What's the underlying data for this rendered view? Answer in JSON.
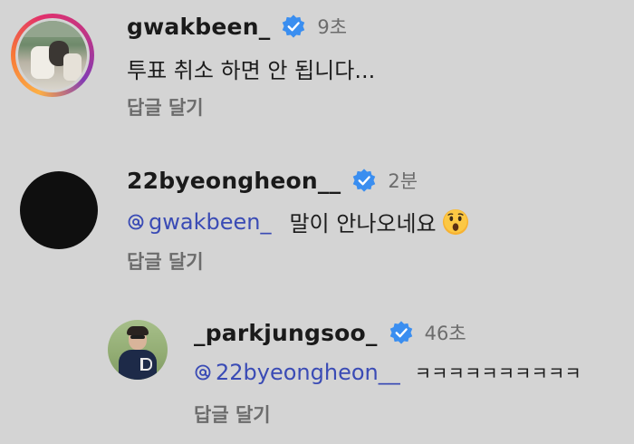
{
  "comments": [
    {
      "username": "gwakbeen_",
      "time": "9초",
      "text": "투표 취소 하면 안 됩니다...",
      "reply_label": "답글 달기"
    },
    {
      "username": "22byeongheon__",
      "time": "2분",
      "mention": "gwakbeen_",
      "text": "말이 안나오네요",
      "emoji": "surprised-face",
      "reply_label": "답글 달기"
    },
    {
      "username": "_parkjungsoo_",
      "time": "46초",
      "mention": "22byeongheon__",
      "text": "ㅋㅋㅋㅋㅋㅋㅋㅋㅋㅋ",
      "reply_label": "답글 달기"
    }
  ],
  "colors": {
    "background": "#d4d4d4",
    "mention": "#3a4bb5",
    "verified": "#3a8ef0",
    "muted": "#6c6c6c"
  }
}
